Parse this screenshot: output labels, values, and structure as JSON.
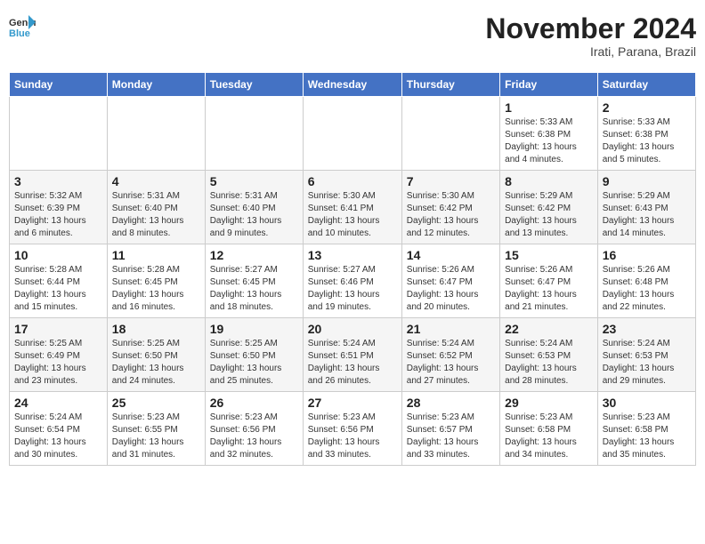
{
  "logo": {
    "general": "General",
    "blue": "Blue"
  },
  "header": {
    "month": "November 2024",
    "location": "Irati, Parana, Brazil"
  },
  "weekdays": [
    "Sunday",
    "Monday",
    "Tuesday",
    "Wednesday",
    "Thursday",
    "Friday",
    "Saturday"
  ],
  "weeks": [
    [
      {
        "day": "",
        "detail": ""
      },
      {
        "day": "",
        "detail": ""
      },
      {
        "day": "",
        "detail": ""
      },
      {
        "day": "",
        "detail": ""
      },
      {
        "day": "",
        "detail": ""
      },
      {
        "day": "1",
        "detail": "Sunrise: 5:33 AM\nSunset: 6:38 PM\nDaylight: 13 hours and 4 minutes."
      },
      {
        "day": "2",
        "detail": "Sunrise: 5:33 AM\nSunset: 6:38 PM\nDaylight: 13 hours and 5 minutes."
      }
    ],
    [
      {
        "day": "3",
        "detail": "Sunrise: 5:32 AM\nSunset: 6:39 PM\nDaylight: 13 hours and 6 minutes."
      },
      {
        "day": "4",
        "detail": "Sunrise: 5:31 AM\nSunset: 6:40 PM\nDaylight: 13 hours and 8 minutes."
      },
      {
        "day": "5",
        "detail": "Sunrise: 5:31 AM\nSunset: 6:40 PM\nDaylight: 13 hours and 9 minutes."
      },
      {
        "day": "6",
        "detail": "Sunrise: 5:30 AM\nSunset: 6:41 PM\nDaylight: 13 hours and 10 minutes."
      },
      {
        "day": "7",
        "detail": "Sunrise: 5:30 AM\nSunset: 6:42 PM\nDaylight: 13 hours and 12 minutes."
      },
      {
        "day": "8",
        "detail": "Sunrise: 5:29 AM\nSunset: 6:42 PM\nDaylight: 13 hours and 13 minutes."
      },
      {
        "day": "9",
        "detail": "Sunrise: 5:29 AM\nSunset: 6:43 PM\nDaylight: 13 hours and 14 minutes."
      }
    ],
    [
      {
        "day": "10",
        "detail": "Sunrise: 5:28 AM\nSunset: 6:44 PM\nDaylight: 13 hours and 15 minutes."
      },
      {
        "day": "11",
        "detail": "Sunrise: 5:28 AM\nSunset: 6:45 PM\nDaylight: 13 hours and 16 minutes."
      },
      {
        "day": "12",
        "detail": "Sunrise: 5:27 AM\nSunset: 6:45 PM\nDaylight: 13 hours and 18 minutes."
      },
      {
        "day": "13",
        "detail": "Sunrise: 5:27 AM\nSunset: 6:46 PM\nDaylight: 13 hours and 19 minutes."
      },
      {
        "day": "14",
        "detail": "Sunrise: 5:26 AM\nSunset: 6:47 PM\nDaylight: 13 hours and 20 minutes."
      },
      {
        "day": "15",
        "detail": "Sunrise: 5:26 AM\nSunset: 6:47 PM\nDaylight: 13 hours and 21 minutes."
      },
      {
        "day": "16",
        "detail": "Sunrise: 5:26 AM\nSunset: 6:48 PM\nDaylight: 13 hours and 22 minutes."
      }
    ],
    [
      {
        "day": "17",
        "detail": "Sunrise: 5:25 AM\nSunset: 6:49 PM\nDaylight: 13 hours and 23 minutes."
      },
      {
        "day": "18",
        "detail": "Sunrise: 5:25 AM\nSunset: 6:50 PM\nDaylight: 13 hours and 24 minutes."
      },
      {
        "day": "19",
        "detail": "Sunrise: 5:25 AM\nSunset: 6:50 PM\nDaylight: 13 hours and 25 minutes."
      },
      {
        "day": "20",
        "detail": "Sunrise: 5:24 AM\nSunset: 6:51 PM\nDaylight: 13 hours and 26 minutes."
      },
      {
        "day": "21",
        "detail": "Sunrise: 5:24 AM\nSunset: 6:52 PM\nDaylight: 13 hours and 27 minutes."
      },
      {
        "day": "22",
        "detail": "Sunrise: 5:24 AM\nSunset: 6:53 PM\nDaylight: 13 hours and 28 minutes."
      },
      {
        "day": "23",
        "detail": "Sunrise: 5:24 AM\nSunset: 6:53 PM\nDaylight: 13 hours and 29 minutes."
      }
    ],
    [
      {
        "day": "24",
        "detail": "Sunrise: 5:24 AM\nSunset: 6:54 PM\nDaylight: 13 hours and 30 minutes."
      },
      {
        "day": "25",
        "detail": "Sunrise: 5:23 AM\nSunset: 6:55 PM\nDaylight: 13 hours and 31 minutes."
      },
      {
        "day": "26",
        "detail": "Sunrise: 5:23 AM\nSunset: 6:56 PM\nDaylight: 13 hours and 32 minutes."
      },
      {
        "day": "27",
        "detail": "Sunrise: 5:23 AM\nSunset: 6:56 PM\nDaylight: 13 hours and 33 minutes."
      },
      {
        "day": "28",
        "detail": "Sunrise: 5:23 AM\nSunset: 6:57 PM\nDaylight: 13 hours and 33 minutes."
      },
      {
        "day": "29",
        "detail": "Sunrise: 5:23 AM\nSunset: 6:58 PM\nDaylight: 13 hours and 34 minutes."
      },
      {
        "day": "30",
        "detail": "Sunrise: 5:23 AM\nSunset: 6:58 PM\nDaylight: 13 hours and 35 minutes."
      }
    ]
  ]
}
